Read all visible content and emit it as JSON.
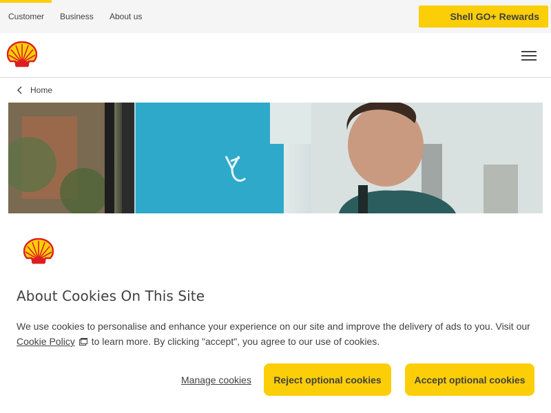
{
  "top_nav": {
    "links": [
      "Customer",
      "Business",
      "About us"
    ],
    "rewards_label": "Shell GO+ Rewards"
  },
  "header": {
    "logo_icon": "shell-pecten-logo",
    "menu_icon": "hamburger-menu-icon"
  },
  "breadcrumb": {
    "icon": "chevron-left-icon",
    "label": "Home"
  },
  "hero": {
    "image": "man-at-ev-charging-station-photo"
  },
  "cookie_banner": {
    "logo_icon": "shell-pecten-logo",
    "title": "About Cookies On This Site",
    "text_before_link": "We use cookies to personalise and enhance your experience on our site and improve the delivery of ads to you. Visit our ",
    "link_label": "Cookie Policy",
    "link_icon": "external-link-icon",
    "text_after_link": " to learn more. By clicking \"accept\", you agree to our use of cookies.",
    "manage_label": "Manage cookies",
    "reject_label": "Reject optional cookies",
    "accept_label": "Accept optional cookies"
  },
  "colors": {
    "brand_yellow": "#fbce07",
    "brand_red": "#dd1d21",
    "text": "#404040",
    "utility_bar_bg": "#f5f5f5"
  }
}
